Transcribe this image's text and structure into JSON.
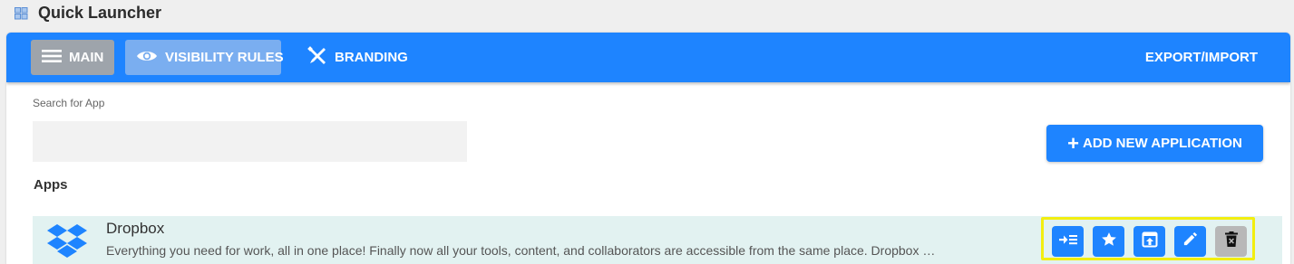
{
  "app": {
    "title": "Quick Launcher"
  },
  "toolbar": {
    "main_label": "MAIN",
    "visibility_label": "VISIBILITY RULES",
    "branding_label": "BRANDING",
    "export_label": "EXPORT/IMPORT"
  },
  "search": {
    "label": "Search for App",
    "value": "",
    "placeholder": ""
  },
  "add_button": {
    "label": "ADD NEW APPLICATION"
  },
  "apps_section": {
    "heading": "Apps",
    "items": [
      {
        "name": "Dropbox",
        "description": "Everything you need for work, all in one place!  Finally now all your tools, content, and collaborators are accessible from the same place. Dropbox …",
        "logo_icon": "dropbox-logo"
      }
    ]
  },
  "row_actions": [
    {
      "icon": "move-to-list-icon"
    },
    {
      "icon": "star-icon"
    },
    {
      "icon": "open-external-icon"
    },
    {
      "icon": "pencil-icon"
    },
    {
      "icon": "trash-icon"
    }
  ],
  "colors": {
    "accent": "#1e84ff",
    "main_tab_bg": "#9ea4ab",
    "visibility_tab_bg": "#7aaef0",
    "row_bg": "#e2f2f1",
    "highlight_border": "#f2ee10",
    "delete_btn_bg": "#b8b8b8"
  }
}
